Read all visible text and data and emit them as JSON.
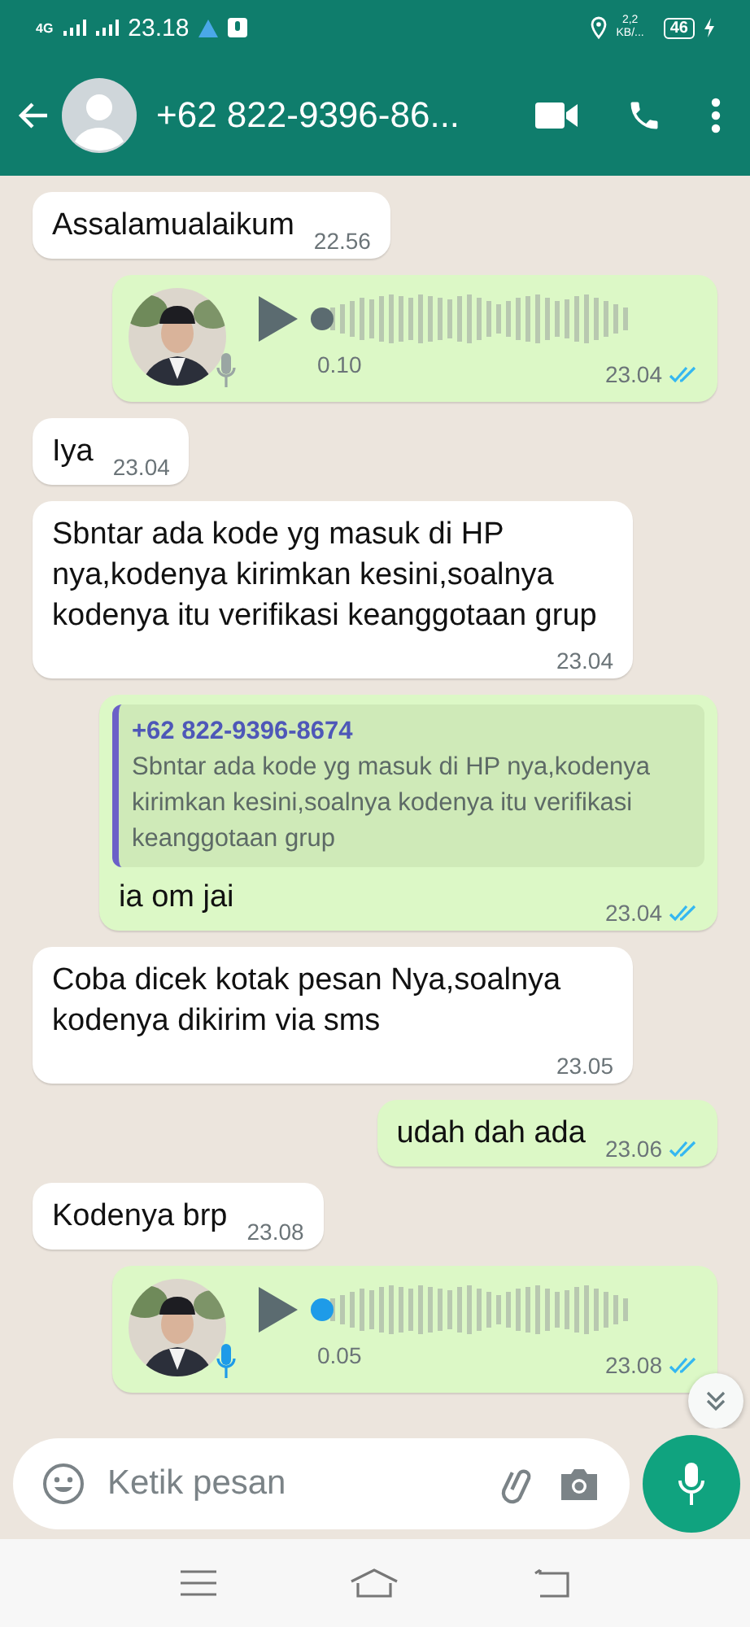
{
  "status_bar": {
    "time": "23.18",
    "network": "4G",
    "speed_value": "2,2",
    "speed_unit": "KB/...",
    "battery": "46",
    "charging": true
  },
  "header": {
    "title": "+62 822-9396-86..."
  },
  "messages": [
    {
      "kind": "text",
      "outgoing": false,
      "text": "Assalamualaikum",
      "time": "22.56"
    },
    {
      "kind": "voice",
      "outgoing": true,
      "duration": "0.10",
      "time": "23.04",
      "read": true,
      "played": false
    },
    {
      "kind": "text",
      "outgoing": false,
      "text": "Iya",
      "time": "23.04"
    },
    {
      "kind": "text",
      "outgoing": false,
      "text": "Sbntar ada kode yg masuk di HP nya,kodenya kirimkan kesini,soalnya kodenya itu verifikasi keanggotaan grup",
      "time": "23.04"
    },
    {
      "kind": "reply",
      "outgoing": true,
      "quote_author": "+62 822-9396-8674",
      "quote_text": "Sbntar ada kode yg masuk di HP nya,kodenya kirimkan kesini,soalnya kodenya itu verifikasi keanggotaan grup",
      "text": "ia om jai",
      "time": "23.04",
      "read": true
    },
    {
      "kind": "text",
      "outgoing": false,
      "text": "Coba dicek kotak pesan Nya,soalnya kodenya dikirim via sms",
      "time": "23.05"
    },
    {
      "kind": "text",
      "outgoing": true,
      "text": "udah dah ada",
      "time": "23.06",
      "read": true
    },
    {
      "kind": "text",
      "outgoing": false,
      "text": "Kodenya brp",
      "time": "23.08"
    },
    {
      "kind": "voice",
      "outgoing": true,
      "duration": "0.05",
      "time": "23.08",
      "read": true,
      "played": true
    }
  ],
  "composer": {
    "placeholder": "Ketik pesan"
  }
}
